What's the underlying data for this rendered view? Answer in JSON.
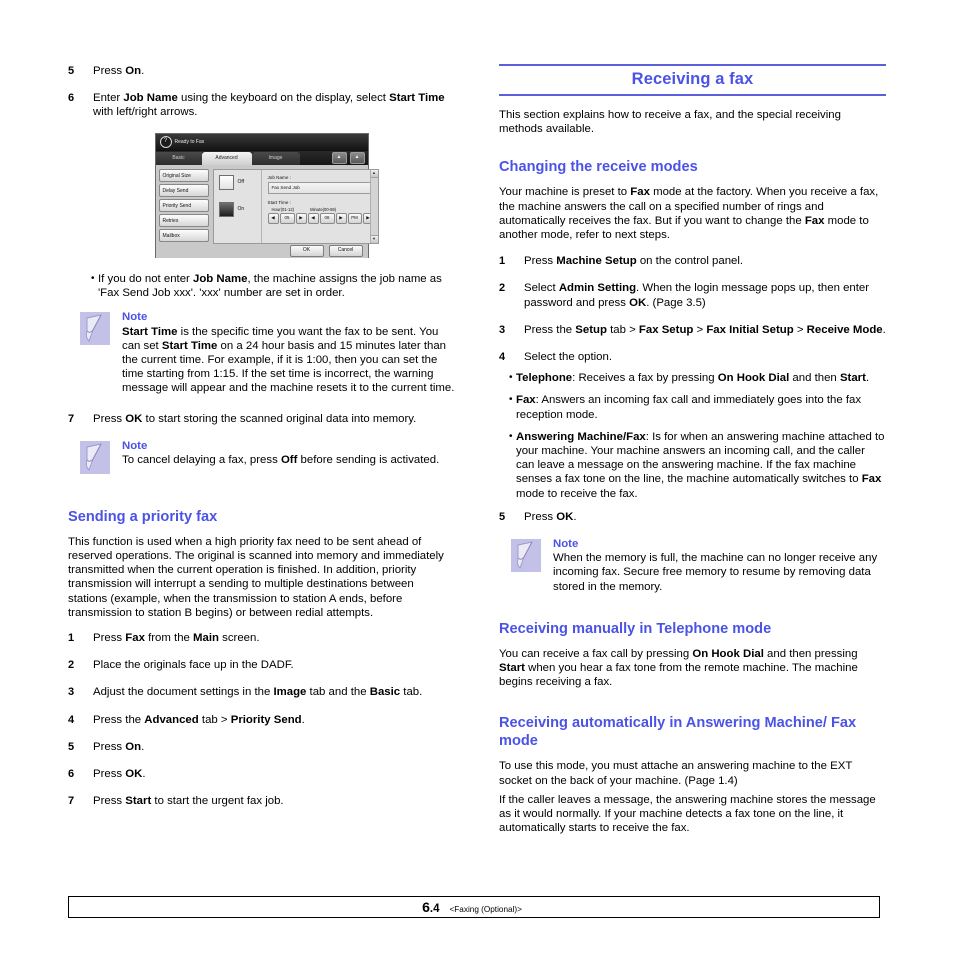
{
  "document": {
    "footer": {
      "page_major": "6",
      "page_sep": ".",
      "page_minor": "4",
      "chapter_label": "<Faxing (Optional)>"
    },
    "accent_color": "#4b53e6",
    "rule_color": "#5b5fdc"
  },
  "left_column": {
    "step5": {
      "num": "5",
      "html": "Press <b>On</b>."
    },
    "step6": {
      "num": "6",
      "html": "Enter <b>Job Name</b> using the keyboard on the display, select <b>Start Time</b> with left/right arrows."
    },
    "figure": {
      "title": "Ready to Fax",
      "help_icon": "?",
      "tabs": [
        "Basic",
        "Advanced",
        "Image"
      ],
      "tab_icons": [
        "eject-icon",
        "home-icon"
      ],
      "menu_items": [
        "Original Size",
        "Delay Send",
        "Priority Send",
        "Retries",
        "Mailbox"
      ],
      "radio_off_label": "Off",
      "radio_on_label": "On",
      "job_name_label": "Job Name      :",
      "job_name_value": "Fax Send Job",
      "start_time_label": "Start Time     :",
      "hour_label": "Hour(01-12)",
      "minute_label": "Minute(00-59)",
      "hour_value": "05",
      "minute_value": "08",
      "ampm_value": "PM",
      "arrow_left": "◀",
      "arrow_right": "▶",
      "scroll_up": "▲",
      "scroll_down": "▼",
      "ok_label": "OK",
      "cancel_label": "Cancel"
    },
    "fig_bullet": {
      "dot": "•",
      "html": "If you do not enter <b>Job Name</b>, the machine assigns the job name as 'Fax Send Job xxx'. 'xxx' number are set in order."
    },
    "note1": {
      "title": "Note",
      "icon": "note-pen-icon",
      "html": "<b>Start Time</b> is the specific time you want the fax to be sent. You can set <b>Start Time</b> on a 24 hour basis and 15 minutes later than the current time. For example, if it is 1:00, then you can set the time starting from 1:15. If the set time is incorrect, the warning message will appear and the machine resets it to the current time."
    },
    "step7": {
      "num": "7",
      "html": "Press <b>OK</b> to start storing the scanned original data into memory."
    },
    "note2": {
      "title": "Note",
      "icon": "note-pen-icon",
      "html": "To cancel delaying a fax, press <b>Off</b> before sending is activated."
    },
    "heading_priority": "Sending a priority fax",
    "priority_intro": "This function is used when a high priority fax need to be sent ahead of reserved operations. The original is scanned into memory and immediately transmitted when the current operation is finished. In addition, priority transmission will interrupt a sending to multiple destinations between stations (example, when the transmission to station A ends, before transmission to station B begins) or between redial attempts.",
    "priority_steps": [
      {
        "num": "1",
        "html": "Press <b>Fax</b> from the <b>Main</b> screen."
      },
      {
        "num": "2",
        "html": "Place the originals face up in the DADF."
      },
      {
        "num": "3",
        "html": "Adjust the document settings in the <b>Image</b> tab and the <b>Basic</b> tab."
      },
      {
        "num": "4",
        "html": "Press the <b>Advanced</b> tab > <b>Priority Send</b>."
      },
      {
        "num": "5",
        "html": "Press <b>On</b>."
      },
      {
        "num": "6",
        "html": "Press <b>OK</b>."
      },
      {
        "num": "7",
        "html": "Press <b>Start</b> to start the urgent fax job."
      }
    ]
  },
  "right_column": {
    "section_title": "Receiving a fax",
    "section_intro": "This section explains how to receive a fax, and the special receiving methods available.",
    "heading_changing": "Changing the receive modes",
    "changing_intro": "Your machine is preset to <b>Fax</b> mode at the factory. When you receive a fax, the machine answers the call on a specified number of rings and automatically receives the fax. But if you want to change the <b>Fax</b> mode to another mode, refer to next steps.",
    "steps": [
      {
        "num": "1",
        "html": "Press <b>Machine Setup</b> on the control panel."
      },
      {
        "num": "2",
        "html": "Select <b>Admin Setting</b>. When the login message pops up, then enter password and press <b>OK</b>. (Page 3.5)"
      },
      {
        "num": "3",
        "html": "Press the <b>Setup</b> tab > <b>Fax Setup</b> > <b>Fax Initial Setup</b> > <b>Receive Mode</b>."
      },
      {
        "num": "4",
        "html": "Select the option."
      }
    ],
    "option_bullets": [
      {
        "dot": "•",
        "html": "<b>Telephone</b>: Receives a fax by pressing <b>On Hook Dial</b> and then <b>Start</b>."
      },
      {
        "dot": "•",
        "html": "<b>Fax</b>: Answers an incoming fax call and immediately goes into the fax reception mode."
      },
      {
        "dot": "•",
        "html": "<b>Answering Machine/Fax</b>: Is for when an answering machine attached to your machine. Your machine answers an incoming call, and the caller can leave a message on the answering machine. If the fax machine senses a fax tone on the line, the machine automatically switches to <b>Fax</b> mode to receive the fax."
      }
    ],
    "step5": {
      "num": "5",
      "html": "Press <b>OK</b>."
    },
    "note": {
      "title": "Note",
      "icon": "note-pen-icon",
      "html": "When the memory is full, the machine can no longer receive any incoming fax. Secure free memory to resume by removing data stored in the memory."
    },
    "heading_manual": "Receiving manually in Telephone mode",
    "manual_text": "You can receive a fax call by pressing <b>On Hook Dial</b> and then pressing <b>Start</b> when you hear a fax tone from the remote machine. The machine begins receiving a fax.",
    "heading_auto": "Receiving automatically in Answering Machine/ Fax mode",
    "auto_text1": "To use this mode, you must attache an answering machine to the EXT socket on the back of your machine. (Page 1.4)",
    "auto_text2": "If the caller leaves a message, the answering machine stores the message as it would normally. If your machine detects a fax tone on the line, it automatically starts to receive the fax."
  }
}
